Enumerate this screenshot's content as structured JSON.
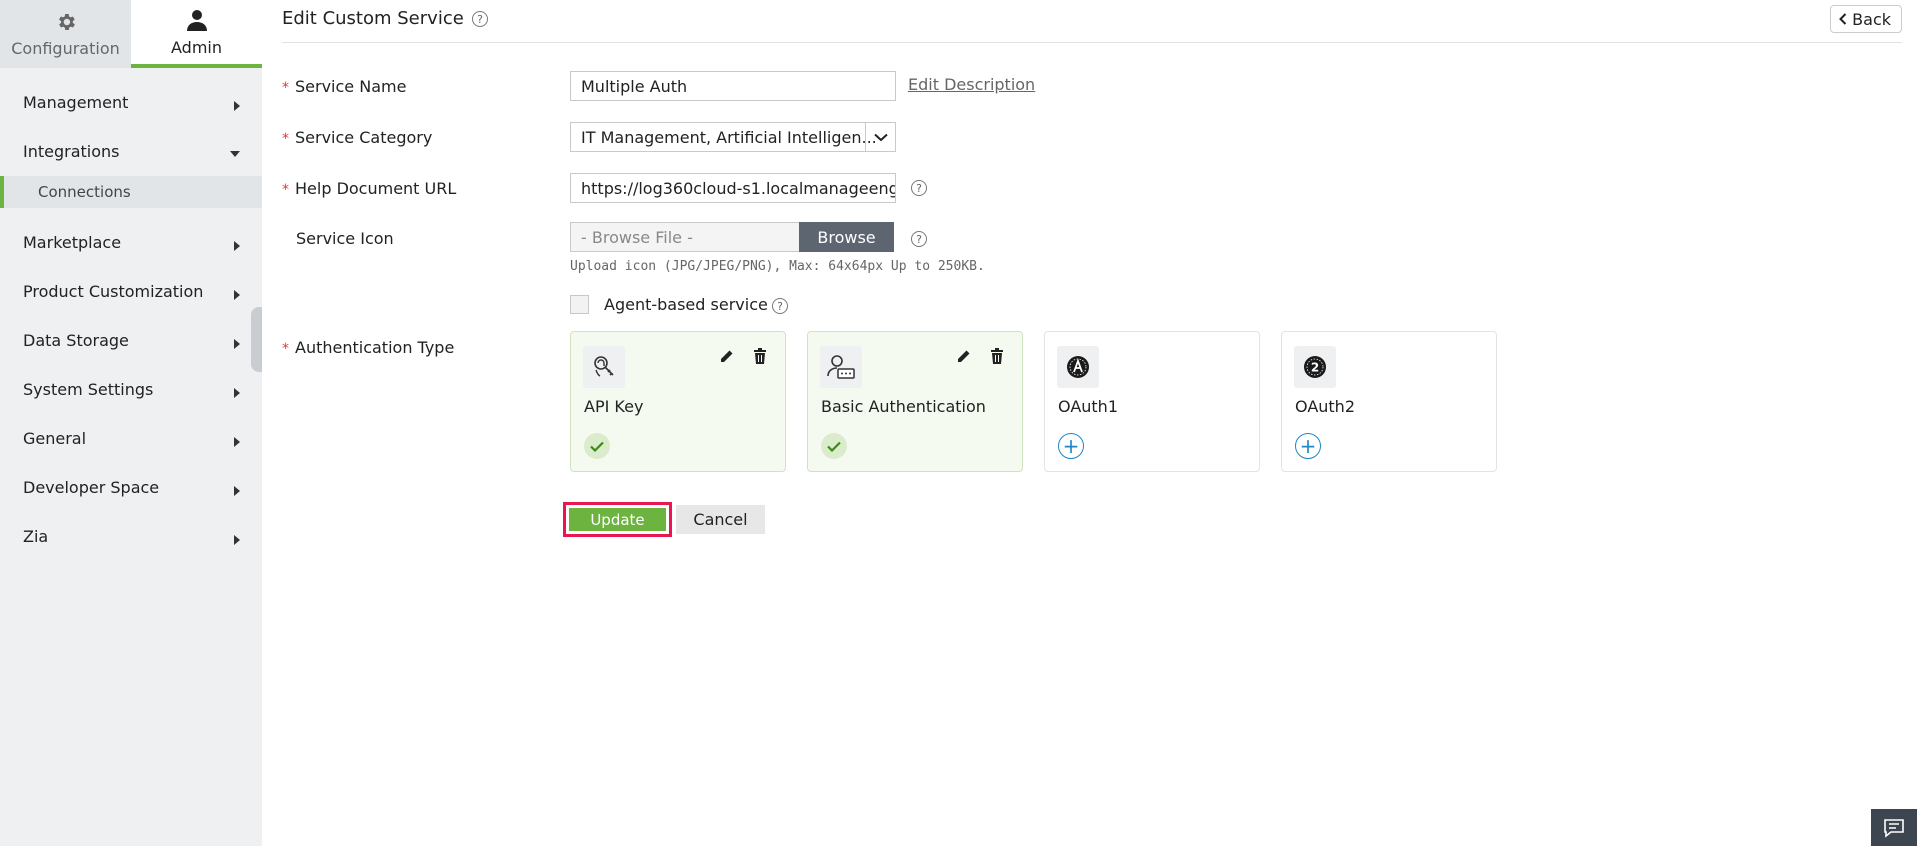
{
  "sidebar": {
    "tabs": [
      {
        "label": "Configuration",
        "icon": "gear-icon"
      },
      {
        "label": "Admin",
        "icon": "user-icon"
      }
    ],
    "items": [
      {
        "label": "Management"
      },
      {
        "label": "Integrations"
      },
      {
        "label": "Connections"
      },
      {
        "label": "Marketplace"
      },
      {
        "label": "Product Customization"
      },
      {
        "label": "Data Storage"
      },
      {
        "label": "System Settings"
      },
      {
        "label": "General"
      },
      {
        "label": "Developer Space"
      },
      {
        "label": "Zia"
      }
    ]
  },
  "header": {
    "title": "Edit Custom Service",
    "back_label": "Back"
  },
  "form": {
    "service_name": {
      "label": "Service Name",
      "value": "Multiple Auth",
      "link": "Edit Description"
    },
    "service_category": {
      "label": "Service Category",
      "value": "IT Management, Artificial Intelligen..."
    },
    "help_url": {
      "label": "Help Document URL",
      "value": "https://log360cloud-s1.localmanageeng"
    },
    "service_icon": {
      "label": "Service Icon",
      "placeholder": "- Browse File -",
      "button": "Browse",
      "hint": "Upload icon (JPG/JPEG/PNG), Max: 64x64px Up to 250KB."
    },
    "agent_based": {
      "label": "Agent-based service"
    },
    "auth_type": {
      "label": "Authentication Type",
      "cards": [
        {
          "label": "API Key",
          "selected": true,
          "icon": "fingerprint-key-icon"
        },
        {
          "label": "Basic Authentication",
          "selected": true,
          "icon": "user-password-icon"
        },
        {
          "label": "OAuth1",
          "selected": false,
          "icon": "oauth1-icon"
        },
        {
          "label": "OAuth2",
          "selected": false,
          "icon": "oauth2-icon"
        }
      ]
    },
    "update_label": "Update",
    "cancel_label": "Cancel"
  },
  "colors": {
    "accent": "#6cb33f",
    "required": "#e53935",
    "highlight": "#e8174f",
    "link": "#1f86c8"
  }
}
